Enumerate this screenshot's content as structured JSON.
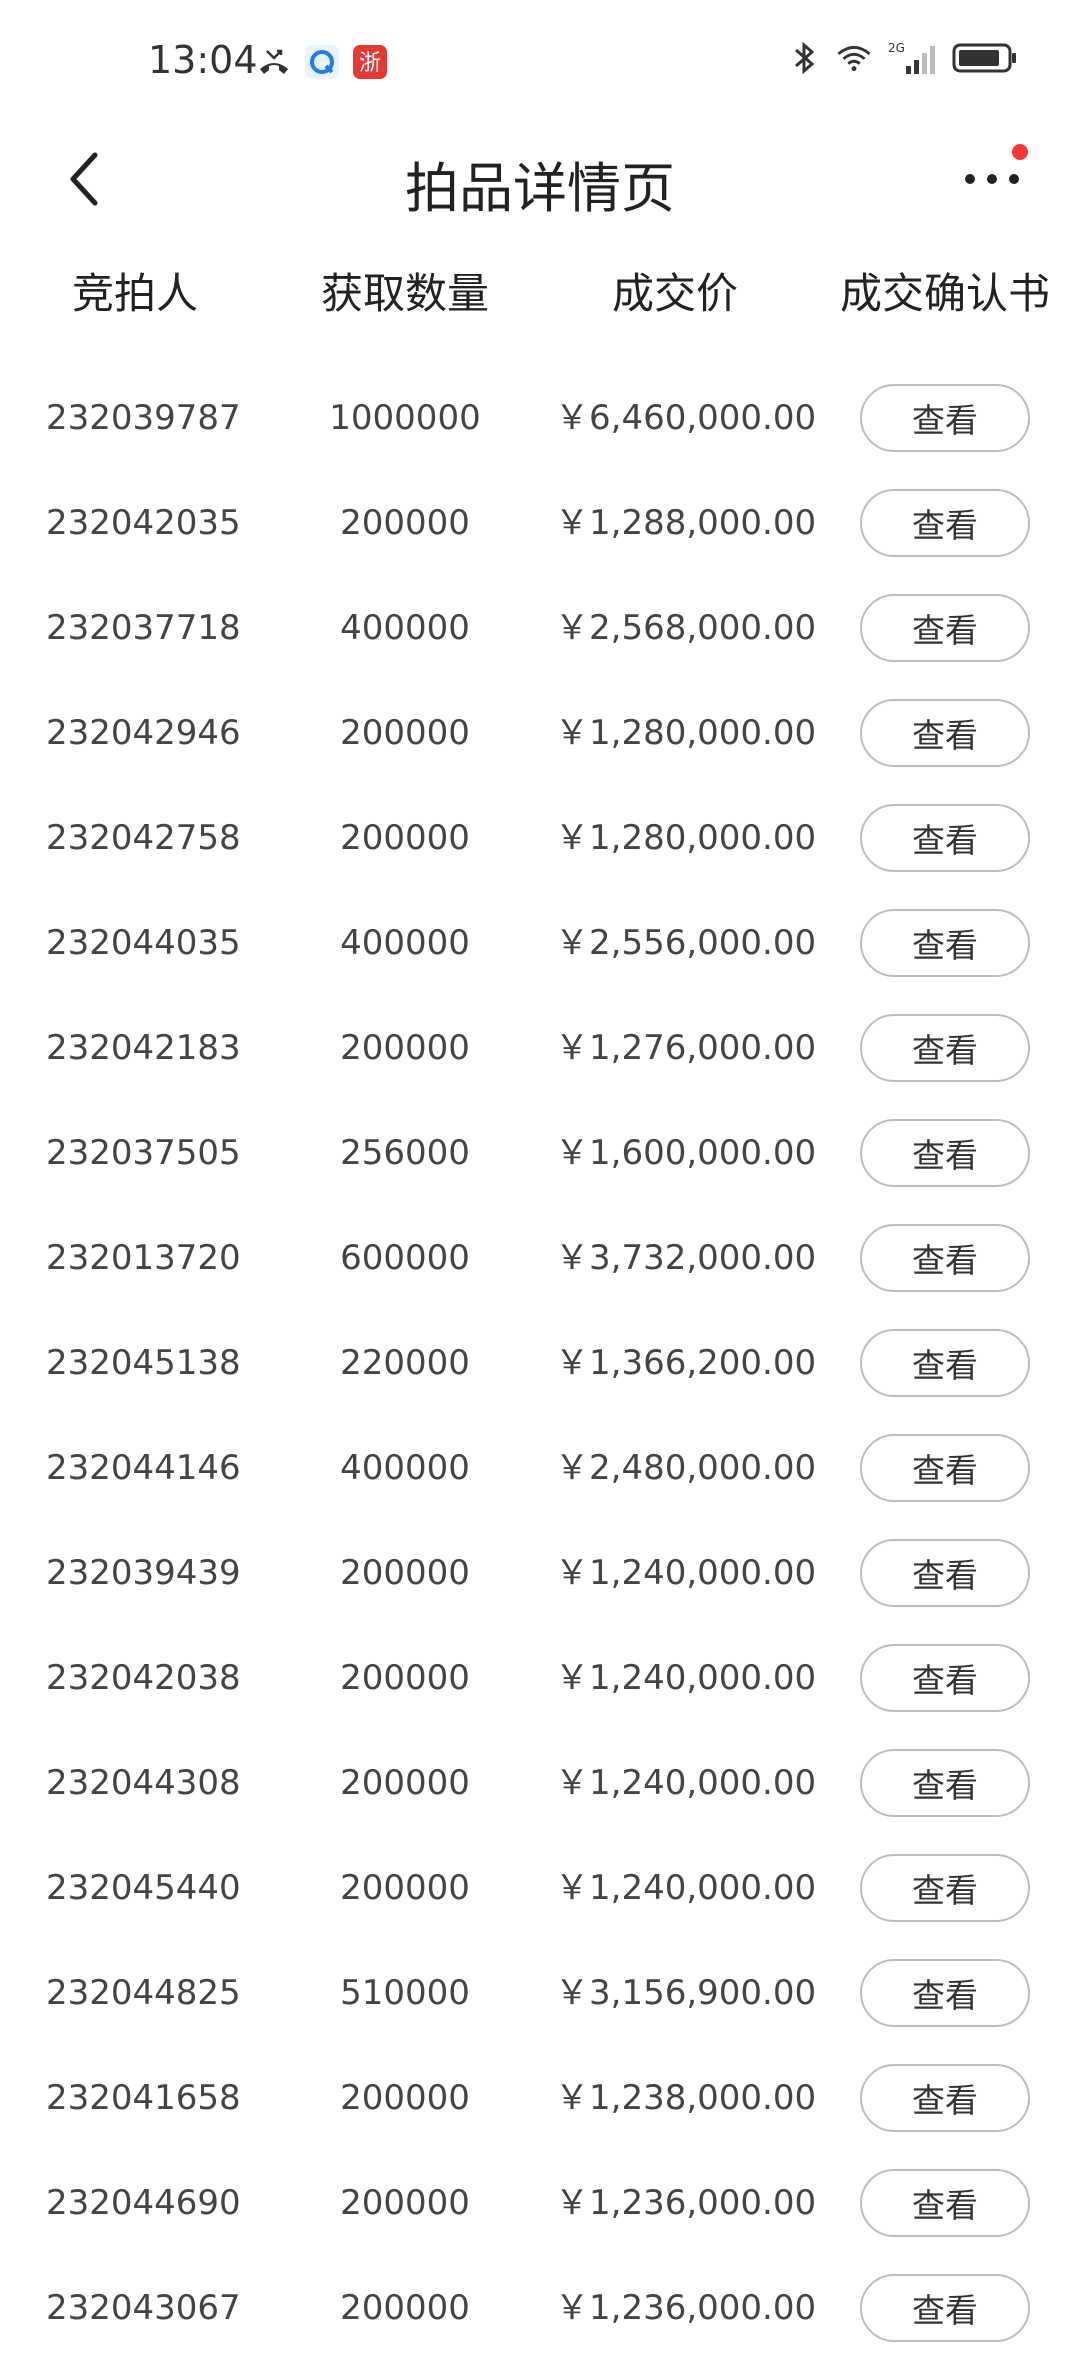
{
  "status_bar": {
    "time": "13:04",
    "left_icons": [
      "missed-call-icon",
      "browser-app-icon",
      "zhejiang-app-icon"
    ],
    "right_icons": [
      "bluetooth-icon",
      "wifi-icon",
      "signal-2g-icon",
      "battery-icon"
    ],
    "signal_label": "2G",
    "app_badge_text": "浙"
  },
  "nav": {
    "title": "拍品详情页",
    "notification_dot_color": "#f2373b"
  },
  "table": {
    "columns": [
      "竞拍人",
      "获取数量",
      "成交价",
      "成交确认书"
    ],
    "view_label": "查看",
    "rows": [
      {
        "bidder": "232039787",
        "quantity": "1000000",
        "price": "￥6,460,000.00"
      },
      {
        "bidder": "232042035",
        "quantity": "200000",
        "price": "￥1,288,000.00"
      },
      {
        "bidder": "232037718",
        "quantity": "400000",
        "price": "￥2,568,000.00"
      },
      {
        "bidder": "232042946",
        "quantity": "200000",
        "price": "￥1,280,000.00"
      },
      {
        "bidder": "232042758",
        "quantity": "200000",
        "price": "￥1,280,000.00"
      },
      {
        "bidder": "232044035",
        "quantity": "400000",
        "price": "￥2,556,000.00"
      },
      {
        "bidder": "232042183",
        "quantity": "200000",
        "price": "￥1,276,000.00"
      },
      {
        "bidder": "232037505",
        "quantity": "256000",
        "price": "￥1,600,000.00"
      },
      {
        "bidder": "232013720",
        "quantity": "600000",
        "price": "￥3,732,000.00"
      },
      {
        "bidder": "232045138",
        "quantity": "220000",
        "price": "￥1,366,200.00"
      },
      {
        "bidder": "232044146",
        "quantity": "400000",
        "price": "￥2,480,000.00"
      },
      {
        "bidder": "232039439",
        "quantity": "200000",
        "price": "￥1,240,000.00"
      },
      {
        "bidder": "232042038",
        "quantity": "200000",
        "price": "￥1,240,000.00"
      },
      {
        "bidder": "232044308",
        "quantity": "200000",
        "price": "￥1,240,000.00"
      },
      {
        "bidder": "232045440",
        "quantity": "200000",
        "price": "￥1,240,000.00"
      },
      {
        "bidder": "232044825",
        "quantity": "510000",
        "price": "￥3,156,900.00"
      },
      {
        "bidder": "232041658",
        "quantity": "200000",
        "price": "￥1,238,000.00"
      },
      {
        "bidder": "232044690",
        "quantity": "200000",
        "price": "￥1,236,000.00"
      },
      {
        "bidder": "232043067",
        "quantity": "200000",
        "price": "￥1,236,000.00"
      }
    ]
  }
}
